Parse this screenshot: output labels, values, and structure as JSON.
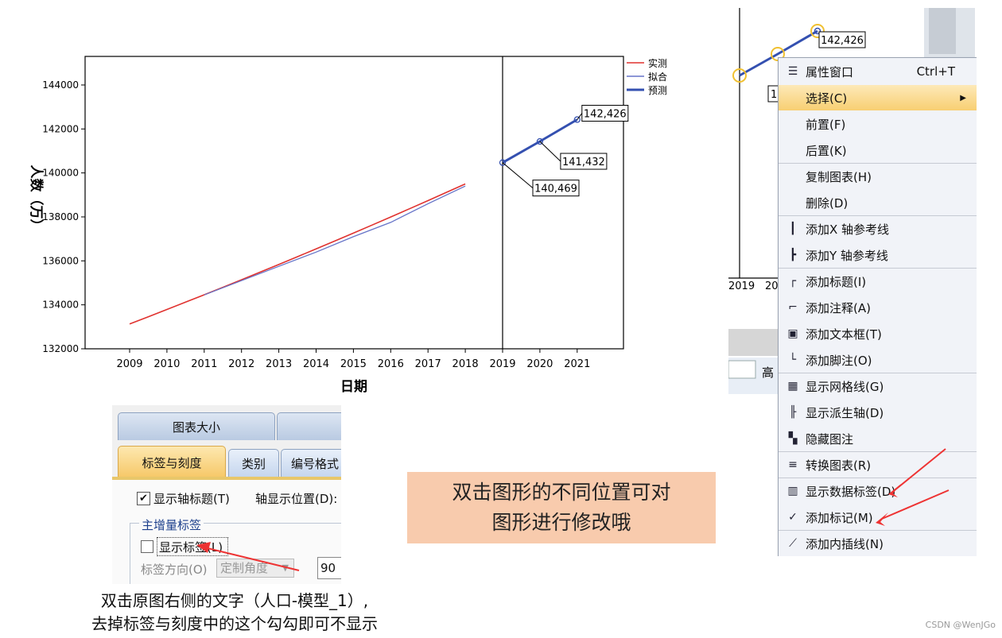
{
  "chart_data": {
    "type": "line",
    "xlabel": "日期",
    "ylabel": "人数（万）",
    "categories": [
      "2009",
      "2010",
      "2011",
      "2012",
      "2013",
      "2014",
      "2015",
      "2016",
      "2017",
      "2018",
      "2019",
      "2020",
      "2021"
    ],
    "yticks": [
      "144000",
      "142000",
      "140000",
      "138000",
      "136000",
      "134000",
      "132000"
    ],
    "ylim": [
      132000,
      145300
    ],
    "legend": [
      "实测",
      "拟合",
      "预测"
    ],
    "legend_position": "top-right",
    "series": [
      {
        "name": "实测",
        "color": "#e0322f",
        "x": [
          2009,
          2018
        ],
        "values": [
          133130,
          139500
        ]
      },
      {
        "name": "拟合",
        "color": "#6674c8",
        "x": [
          2011,
          2012,
          2013,
          2014,
          2015,
          2016,
          2017,
          2018
        ],
        "values": [
          134450,
          135100,
          135750,
          136400,
          137100,
          137750,
          138600,
          139400
        ]
      },
      {
        "name": "预测",
        "color": "#3450b0",
        "x": [
          2019,
          2020,
          2021
        ],
        "values": [
          140469,
          141432,
          142426
        ]
      }
    ],
    "data_labels": [
      "140,469",
      "141,432",
      "142,426"
    ],
    "reference_line_x": 2019
  },
  "context_chart": {
    "label": "142,426",
    "label_partial": "1",
    "ticks": [
      "2019",
      "20"
    ],
    "partial_text": "高"
  },
  "context_menu": {
    "items": [
      {
        "icon": "properties-icon",
        "label": "属性窗口",
        "shortcut": "Ctrl+T"
      },
      {
        "icon": "",
        "label": "选择(C)",
        "submenu": true
      },
      {
        "icon": "",
        "label": "前置(F)"
      },
      {
        "icon": "",
        "label": "后置(K)"
      },
      {
        "icon": "",
        "label": "复制图表(H)"
      },
      {
        "icon": "",
        "label": "删除(D)"
      },
      {
        "icon": "x-ref-line-icon",
        "label": "添加X 轴参考线"
      },
      {
        "icon": "y-ref-line-icon",
        "label": "添加Y 轴参考线"
      },
      {
        "icon": "title-icon",
        "label": "添加标题(I)"
      },
      {
        "icon": "annotation-icon",
        "label": "添加注释(A)"
      },
      {
        "icon": "text-box-icon",
        "label": "添加文本框(T)"
      },
      {
        "icon": "footnote-icon",
        "label": "添加脚注(O)"
      },
      {
        "icon": "gridlines-icon",
        "label": "显示网格线(G)"
      },
      {
        "icon": "derived-axis-icon",
        "label": "显示派生轴(D)"
      },
      {
        "icon": "hide-legend-icon",
        "label": "隐藏图注"
      },
      {
        "icon": "transpose-icon",
        "label": "转换图表(R)"
      },
      {
        "icon": "data-labels-icon",
        "label": "显示数据标签(D)"
      },
      {
        "icon": "markers-icon",
        "label": "添加标记(M)"
      },
      {
        "icon": "interpolation-icon",
        "label": "添加内插线(N)"
      }
    ]
  },
  "dialog": {
    "tabs_row1": [
      "图表大小"
    ],
    "tabs_row2": [
      "标签与刻度",
      "类别",
      "编号格式"
    ],
    "show_axis_title": "显示轴标题(T)",
    "axis_position_label": "轴显示位置(D):",
    "group_title": "主增量标签",
    "show_labels": "显示标签(L)",
    "label_direction": "标签方向(O)",
    "direction_value": "定制角度",
    "angle_value": "90"
  },
  "notes": {
    "box_line1": "双击图形的不同位置可对",
    "box_line2": "图形进行修改哦",
    "left_line1": "双击原图右侧的文字（人口-模型_1）,",
    "left_line2": "去掉标签与刻度中的这个勾勾即可不显示"
  },
  "watermark": "CSDN @WenJGo"
}
